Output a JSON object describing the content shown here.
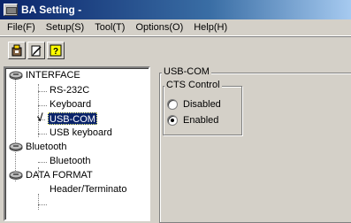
{
  "window": {
    "title": "BA Setting -"
  },
  "menu": [
    "File(F)",
    "Setup(S)",
    "Tool(T)",
    "Options(O)",
    "Help(H)"
  ],
  "toolbar": {
    "buttons": [
      {
        "name": "save-icon"
      },
      {
        "name": "edit-icon"
      },
      {
        "name": "help-icon"
      }
    ]
  },
  "tree": {
    "interface": "INTERFACE",
    "rs232c": "RS-232C",
    "keyboard": "Keyboard",
    "checkmark": "√",
    "usbcom": "USB-COM",
    "usbkeyboard": "USB keyboard",
    "bluetooth_group": "Bluetooth",
    "bluetooth_item": "Bluetooth",
    "dataformat": "DATA FORMAT",
    "header": "Header/Terminato"
  },
  "panel": {
    "group_title": "USB-COM",
    "cts_title": "CTS Control",
    "options": [
      "Disabled",
      "Enabled"
    ],
    "selected": "Enabled"
  }
}
